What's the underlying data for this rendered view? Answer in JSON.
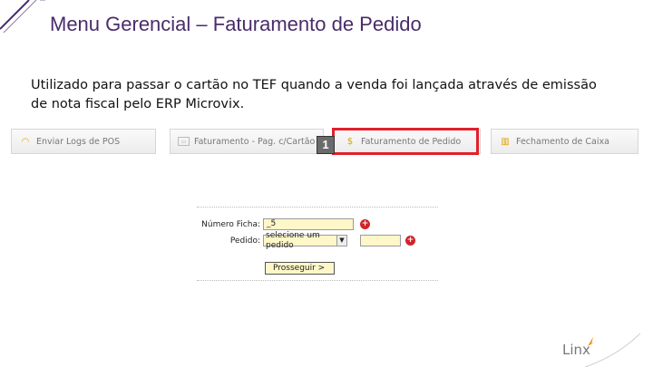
{
  "slide": {
    "title": "Menu Gerencial – Faturamento de Pedido",
    "description_line1": "Utilizado para passar o cartão no TEF quando a venda foi lançada através de emissão",
    "description_line2": "de nota fiscal pelo ERP Microvix."
  },
  "menu": {
    "items": [
      {
        "label": "Enviar Logs de POS",
        "icon": "arc-icon"
      },
      {
        "label": "Faturamento - Pag. c/Cartão",
        "icon": "card-icon"
      },
      {
        "label": "Faturamento de Pedido",
        "icon": "dollar-icon"
      },
      {
        "label": "Fechamento de Caixa",
        "icon": "chart-icon"
      }
    ],
    "step_badge": "1",
    "highlight_color": "#e0202a"
  },
  "form": {
    "ficha_label": "Número Ficha:",
    "ficha_value": "_5",
    "pedido_label": "Pedido:",
    "pedido_selected": "selecione um pedido",
    "submit_label": "Prosseguir >"
  },
  "brand": {
    "logo_text": "Linx",
    "accent": "#f28c00"
  }
}
